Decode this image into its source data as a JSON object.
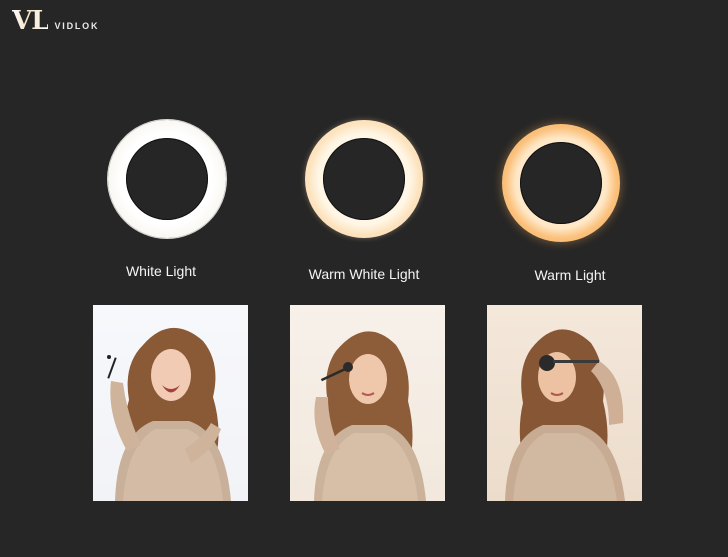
{
  "brand": {
    "mark": "VL",
    "name": "VIDLOK"
  },
  "modes": [
    {
      "label": "White Light",
      "ring_color": "#ffffff",
      "photo_tone": "#f3f4f7"
    },
    {
      "label": "Warm White Light",
      "ring_color": "#fde4c0",
      "photo_tone": "#f3e9de"
    },
    {
      "label": "Warm Light",
      "ring_color": "#fbc27e",
      "photo_tone": "#eddccb"
    }
  ],
  "colors": {
    "background": "#262626",
    "label_text": "#f5f5f5"
  }
}
